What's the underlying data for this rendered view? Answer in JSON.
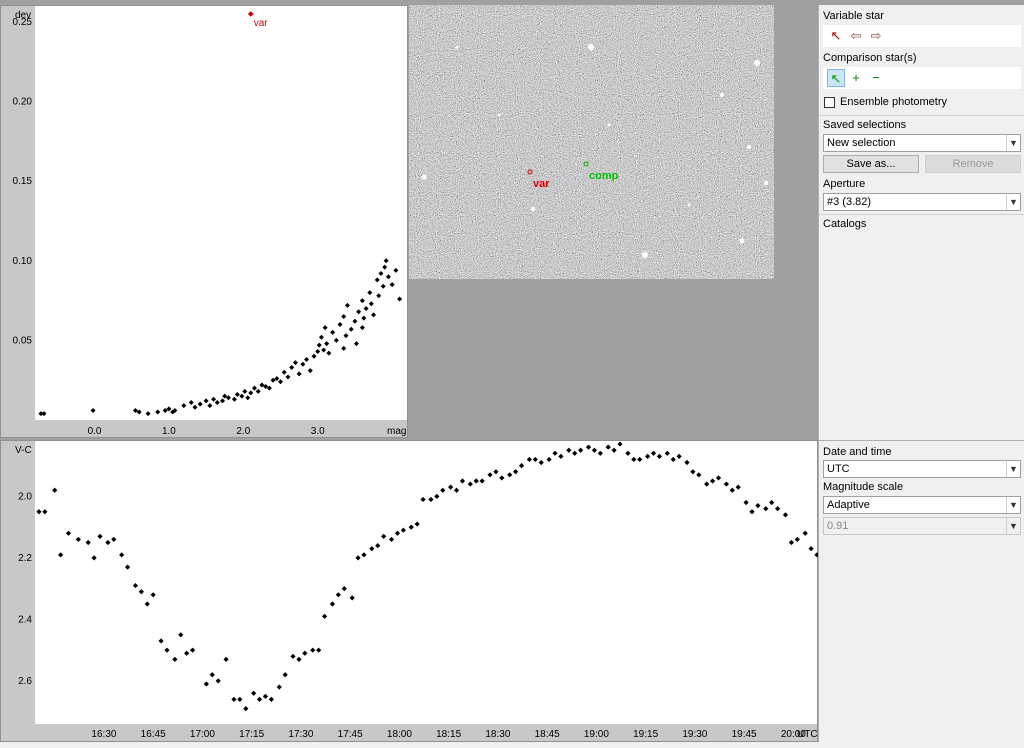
{
  "status_bar": {
    "text": ""
  },
  "top_plot": {
    "ylabel": "dev",
    "xlabel": "mag",
    "annotation": "var",
    "chart_data": {
      "type": "scatter",
      "xlim": [
        -0.8,
        4.2
      ],
      "ylim": [
        0.0,
        0.26
      ],
      "yticks": [
        "0.25",
        "0.20",
        "0.15",
        "0.10",
        "0.05"
      ],
      "xticks": [
        "0.0",
        "1.0",
        "2.0",
        "3.0"
      ],
      "highlight_point": {
        "x": 2.1,
        "y": 0.255,
        "label": "var",
        "color": "#d00000"
      },
      "points": [
        [
          -0.72,
          0.004
        ],
        [
          -0.68,
          0.004
        ],
        [
          -0.02,
          0.006
        ],
        [
          0.55,
          0.006
        ],
        [
          0.6,
          0.005
        ],
        [
          0.72,
          0.004
        ],
        [
          0.85,
          0.005
        ],
        [
          0.95,
          0.006
        ],
        [
          1.0,
          0.007
        ],
        [
          1.05,
          0.005
        ],
        [
          1.08,
          0.006
        ],
        [
          1.2,
          0.009
        ],
        [
          1.3,
          0.011
        ],
        [
          1.35,
          0.008
        ],
        [
          1.42,
          0.01
        ],
        [
          1.5,
          0.012
        ],
        [
          1.55,
          0.009
        ],
        [
          1.6,
          0.013
        ],
        [
          1.65,
          0.011
        ],
        [
          1.72,
          0.012
        ],
        [
          1.8,
          0.014
        ],
        [
          1.88,
          0.013
        ],
        [
          1.92,
          0.016
        ],
        [
          1.98,
          0.015
        ],
        [
          2.02,
          0.018
        ],
        [
          2.06,
          0.014
        ],
        [
          2.1,
          0.017
        ],
        [
          2.15,
          0.02
        ],
        [
          2.2,
          0.018
        ],
        [
          2.25,
          0.022
        ],
        [
          2.3,
          0.021
        ],
        [
          2.35,
          0.02
        ],
        [
          2.4,
          0.025
        ],
        [
          2.5,
          0.024
        ],
        [
          2.55,
          0.03
        ],
        [
          2.6,
          0.027
        ],
        [
          2.65,
          0.033
        ],
        [
          2.7,
          0.036
        ],
        [
          2.75,
          0.029
        ],
        [
          2.8,
          0.035
        ],
        [
          2.85,
          0.038
        ],
        [
          2.9,
          0.031
        ],
        [
          2.95,
          0.04
        ],
        [
          3.0,
          0.043
        ],
        [
          3.02,
          0.047
        ],
        [
          3.05,
          0.052
        ],
        [
          3.08,
          0.044
        ],
        [
          3.1,
          0.058
        ],
        [
          3.12,
          0.048
        ],
        [
          3.15,
          0.042
        ],
        [
          3.2,
          0.055
        ],
        [
          3.25,
          0.05
        ],
        [
          3.3,
          0.06
        ],
        [
          3.35,
          0.065
        ],
        [
          3.38,
          0.053
        ],
        [
          3.4,
          0.072
        ],
        [
          3.45,
          0.057
        ],
        [
          3.5,
          0.062
        ],
        [
          3.52,
          0.048
        ],
        [
          3.55,
          0.068
        ],
        [
          3.6,
          0.075
        ],
        [
          3.62,
          0.064
        ],
        [
          3.65,
          0.07
        ],
        [
          3.7,
          0.08
        ],
        [
          3.72,
          0.073
        ],
        [
          3.75,
          0.066
        ],
        [
          3.8,
          0.088
        ],
        [
          3.82,
          0.078
        ],
        [
          3.85,
          0.092
        ],
        [
          3.88,
          0.084
        ],
        [
          3.9,
          0.096
        ],
        [
          3.92,
          0.1
        ],
        [
          3.95,
          0.09
        ],
        [
          4.0,
          0.085
        ],
        [
          4.05,
          0.094
        ],
        [
          4.1,
          0.076
        ],
        [
          3.35,
          0.045
        ],
        [
          3.6,
          0.058
        ],
        [
          2.45,
          0.026
        ],
        [
          1.75,
          0.015
        ]
      ]
    }
  },
  "image_view": {
    "var_label": "var",
    "comp_label": "comp"
  },
  "right_panel": {
    "variable_star_label": "Variable star",
    "comparison_label": "Comparison star(s)",
    "ensemble_label": "Ensemble photometry",
    "saved_label": "Saved selections",
    "saved_value": "New selection",
    "save_as_label": "Save as...",
    "remove_label": "Remove",
    "aperture_label": "Aperture",
    "aperture_value": "#3 (3.82)",
    "catalogs_label": "Catalogs",
    "datetime_label": "Date and time",
    "datetime_value": "UTC",
    "magscale_label": "Magnitude scale",
    "magscale_value": "Adaptive",
    "magscale_number": "0.91"
  },
  "bottom_plot": {
    "ylabel": "V-C",
    "xlabel": "UTC",
    "chart_data": {
      "type": "scatter",
      "xlim": [
        -0.35,
        3.62
      ],
      "ylim": [
        1.82,
        2.74
      ],
      "yticks": [
        {
          "v": 2.0,
          "t": "2.0"
        },
        {
          "v": 2.2,
          "t": "2.2"
        },
        {
          "v": 2.4,
          "t": "2.4"
        },
        {
          "v": 2.6,
          "t": "2.6"
        }
      ],
      "xticks": [
        "16:30",
        "16:45",
        "17:00",
        "17:15",
        "17:30",
        "17:45",
        "18:00",
        "18:15",
        "18:30",
        "18:45",
        "19:00",
        "19:15",
        "19:30",
        "19:45",
        "20:00"
      ],
      "x_units": "hours after 16:30 UTC",
      "values": [
        [
          -0.33,
          2.05
        ],
        [
          -0.3,
          2.05
        ],
        [
          -0.25,
          1.98
        ],
        [
          -0.22,
          2.19
        ],
        [
          -0.18,
          2.12
        ],
        [
          -0.13,
          2.14
        ],
        [
          -0.08,
          2.15
        ],
        [
          -0.05,
          2.2
        ],
        [
          -0.02,
          2.13
        ],
        [
          0.02,
          2.15
        ],
        [
          0.05,
          2.14
        ],
        [
          0.09,
          2.19
        ],
        [
          0.12,
          2.23
        ],
        [
          0.16,
          2.29
        ],
        [
          0.19,
          2.31
        ],
        [
          0.22,
          2.35
        ],
        [
          0.25,
          2.32
        ],
        [
          0.29,
          2.47
        ],
        [
          0.32,
          2.5
        ],
        [
          0.36,
          2.53
        ],
        [
          0.39,
          2.45
        ],
        [
          0.42,
          2.51
        ],
        [
          0.45,
          2.5
        ],
        [
          0.52,
          2.61
        ],
        [
          0.55,
          2.58
        ],
        [
          0.58,
          2.6
        ],
        [
          0.62,
          2.53
        ],
        [
          0.66,
          2.66
        ],
        [
          0.69,
          2.66
        ],
        [
          0.72,
          2.69
        ],
        [
          0.76,
          2.64
        ],
        [
          0.79,
          2.66
        ],
        [
          0.82,
          2.65
        ],
        [
          0.85,
          2.66
        ],
        [
          0.89,
          2.62
        ],
        [
          0.92,
          2.58
        ],
        [
          0.96,
          2.52
        ],
        [
          0.99,
          2.53
        ],
        [
          1.02,
          2.51
        ],
        [
          1.06,
          2.5
        ],
        [
          1.09,
          2.5
        ],
        [
          1.12,
          2.39
        ],
        [
          1.16,
          2.35
        ],
        [
          1.19,
          2.32
        ],
        [
          1.22,
          2.3
        ],
        [
          1.26,
          2.33
        ],
        [
          1.29,
          2.2
        ],
        [
          1.32,
          2.19
        ],
        [
          1.36,
          2.17
        ],
        [
          1.39,
          2.16
        ],
        [
          1.42,
          2.13
        ],
        [
          1.46,
          2.14
        ],
        [
          1.49,
          2.12
        ],
        [
          1.52,
          2.11
        ],
        [
          1.56,
          2.1
        ],
        [
          1.59,
          2.09
        ],
        [
          1.62,
          2.01
        ],
        [
          1.66,
          2.01
        ],
        [
          1.69,
          2.0
        ],
        [
          1.72,
          1.98
        ],
        [
          1.76,
          1.97
        ],
        [
          1.79,
          1.98
        ],
        [
          1.82,
          1.95
        ],
        [
          1.86,
          1.96
        ],
        [
          1.89,
          1.95
        ],
        [
          1.92,
          1.95
        ],
        [
          1.96,
          1.93
        ],
        [
          1.99,
          1.92
        ],
        [
          2.02,
          1.94
        ],
        [
          2.06,
          1.93
        ],
        [
          2.09,
          1.92
        ],
        [
          2.12,
          1.9
        ],
        [
          2.16,
          1.88
        ],
        [
          2.19,
          1.88
        ],
        [
          2.22,
          1.89
        ],
        [
          2.26,
          1.88
        ],
        [
          2.29,
          1.86
        ],
        [
          2.32,
          1.87
        ],
        [
          2.36,
          1.85
        ],
        [
          2.39,
          1.86
        ],
        [
          2.42,
          1.85
        ],
        [
          2.46,
          1.84
        ],
        [
          2.49,
          1.85
        ],
        [
          2.52,
          1.86
        ],
        [
          2.56,
          1.84
        ],
        [
          2.59,
          1.85
        ],
        [
          2.62,
          1.83
        ],
        [
          2.66,
          1.86
        ],
        [
          2.69,
          1.88
        ],
        [
          2.72,
          1.88
        ],
        [
          2.76,
          1.87
        ],
        [
          2.79,
          1.86
        ],
        [
          2.82,
          1.87
        ],
        [
          2.86,
          1.86
        ],
        [
          2.89,
          1.88
        ],
        [
          2.92,
          1.87
        ],
        [
          2.96,
          1.89
        ],
        [
          2.99,
          1.92
        ],
        [
          3.02,
          1.93
        ],
        [
          3.06,
          1.96
        ],
        [
          3.09,
          1.95
        ],
        [
          3.12,
          1.94
        ],
        [
          3.16,
          1.96
        ],
        [
          3.19,
          1.98
        ],
        [
          3.22,
          1.97
        ],
        [
          3.26,
          2.02
        ],
        [
          3.29,
          2.05
        ],
        [
          3.32,
          2.03
        ],
        [
          3.36,
          2.04
        ],
        [
          3.39,
          2.02
        ],
        [
          3.42,
          2.04
        ],
        [
          3.46,
          2.06
        ],
        [
          3.49,
          2.15
        ],
        [
          3.52,
          2.14
        ],
        [
          3.56,
          2.12
        ],
        [
          3.59,
          2.17
        ],
        [
          3.62,
          2.19
        ]
      ]
    }
  }
}
